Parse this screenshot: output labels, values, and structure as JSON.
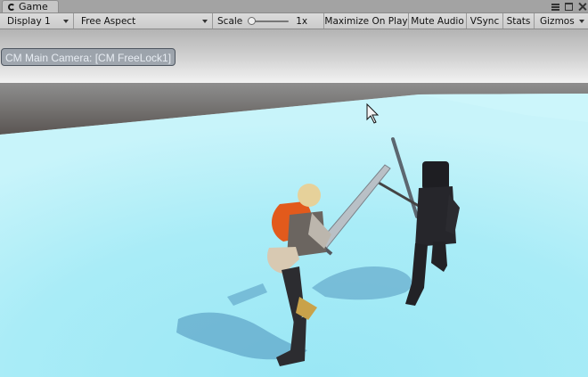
{
  "window": {
    "tab_label": "Game"
  },
  "toolbar": {
    "display": "Display 1",
    "aspect": "Free Aspect",
    "scale_label": "Scale",
    "scale_value": "1x",
    "scale_fraction": 0.0,
    "maximize": "Maximize On Play",
    "mute": "Mute Audio",
    "vsync": "VSync",
    "stats": "Stats",
    "gizmos": "Gizmos"
  },
  "viewport": {
    "camera_label": "CM Main Camera: [CM FreeLock1]"
  }
}
